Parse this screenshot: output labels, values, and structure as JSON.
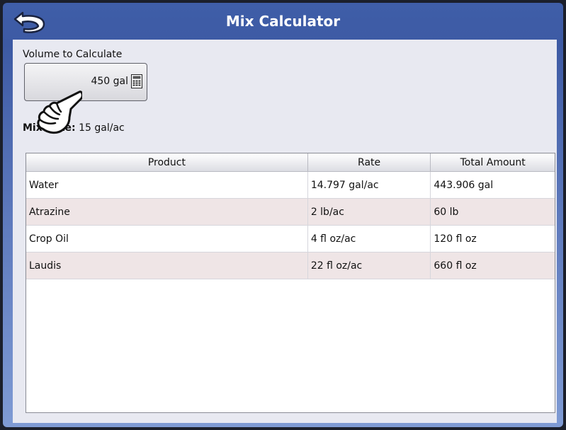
{
  "header": {
    "title": "Mix Calculator"
  },
  "volume": {
    "label": "Volume to Calculate",
    "value": "450 gal"
  },
  "mix_rate": {
    "label": "Mix Rate:",
    "value": "15 gal/ac"
  },
  "table": {
    "columns": [
      "Product",
      "Rate",
      "Total Amount"
    ],
    "rows": [
      {
        "product": "Water",
        "rate": "14.797 gal/ac",
        "total": "443.906 gal"
      },
      {
        "product": "Atrazine",
        "rate": "2 lb/ac",
        "total": "60 lb"
      },
      {
        "product": "Crop Oil",
        "rate": "4 fl oz/ac",
        "total": "120 fl oz"
      },
      {
        "product": "Laudis",
        "rate": "22 fl oz/ac",
        "total": "660 fl oz"
      }
    ]
  },
  "colors": {
    "title_bar": "#3d5aa4",
    "content_bg": "#e8e9f1",
    "row_alt": "#efe5e6"
  },
  "icons": [
    "back-arrow-icon",
    "calculator-icon",
    "pointing-hand-icon"
  ]
}
